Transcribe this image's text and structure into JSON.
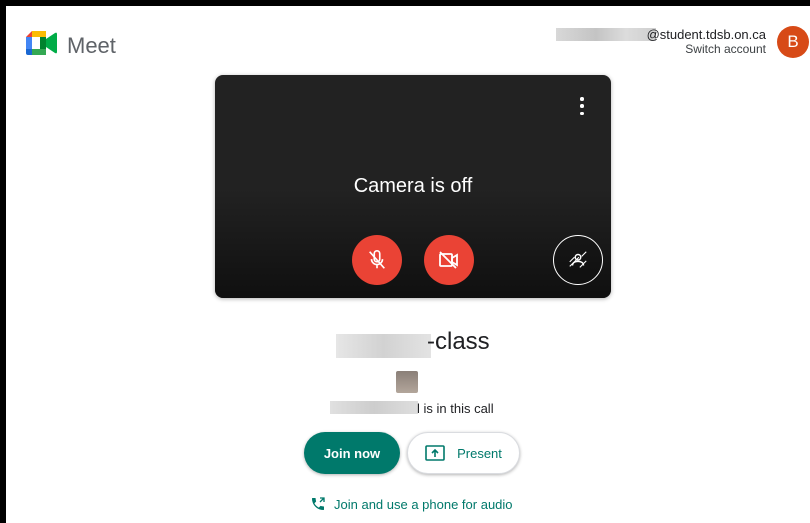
{
  "header": {
    "app_name": "Meet",
    "account_email": "@student.tdsb.on.ca",
    "switch_account": "Switch account",
    "avatar_initial": "B",
    "avatar_color": "#d74a17"
  },
  "preview": {
    "status_text": "Camera is off",
    "more_icon": "more-vert-icon",
    "mic_icon": "mic-off-icon",
    "camera_icon": "videocam-off-icon",
    "effects_icon": "visual-effects-icon",
    "button_color": "#ea4335"
  },
  "meeting": {
    "name_suffix": "-class",
    "participants_text": "l is in this call"
  },
  "actions": {
    "join_label": "Join now",
    "present_label": "Present",
    "phone_label": "Join and use a phone for audio",
    "accent_color": "#00796b"
  }
}
